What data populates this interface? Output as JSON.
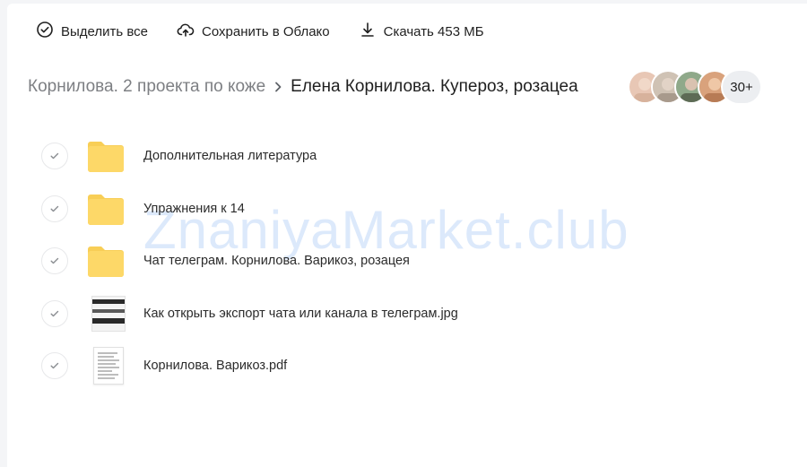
{
  "toolbar": {
    "select_all_label": "Выделить все",
    "save_cloud_label": "Сохранить в Облако",
    "download_label": "Скачать 453 МБ"
  },
  "breadcrumb": {
    "parent": "Корнилова. 2 проекта по коже",
    "current": "Елена Корнилова. Купероз, розацеа"
  },
  "participants": {
    "more_label": "30+",
    "avatar_colors": [
      "#e8c7b5",
      "#cfc2b4",
      "#8fa98a",
      "#d9a27c"
    ]
  },
  "files": [
    {
      "name": "Дополнительная литература",
      "type": "folder",
      "icon": "folder-icon"
    },
    {
      "name": "Упражнения к 14",
      "type": "folder",
      "icon": "folder-icon"
    },
    {
      "name": "Чат телеграм. Корнилова. Варикоз, розацея",
      "type": "folder",
      "icon": "folder-icon"
    },
    {
      "name": "Как открыть экспорт чата или канала в телеграм.jpg",
      "type": "image",
      "icon": "image-thumbnail"
    },
    {
      "name": "Корнилова. Варикоз.pdf",
      "type": "pdf",
      "icon": "pdf-thumbnail"
    }
  ],
  "watermark": "ZnaniyaMarket.club",
  "colors": {
    "folder": "#fdd868",
    "folder_tab": "#f8ce56",
    "muted_text": "#7d7f83",
    "watermark": "#dce9fb"
  }
}
